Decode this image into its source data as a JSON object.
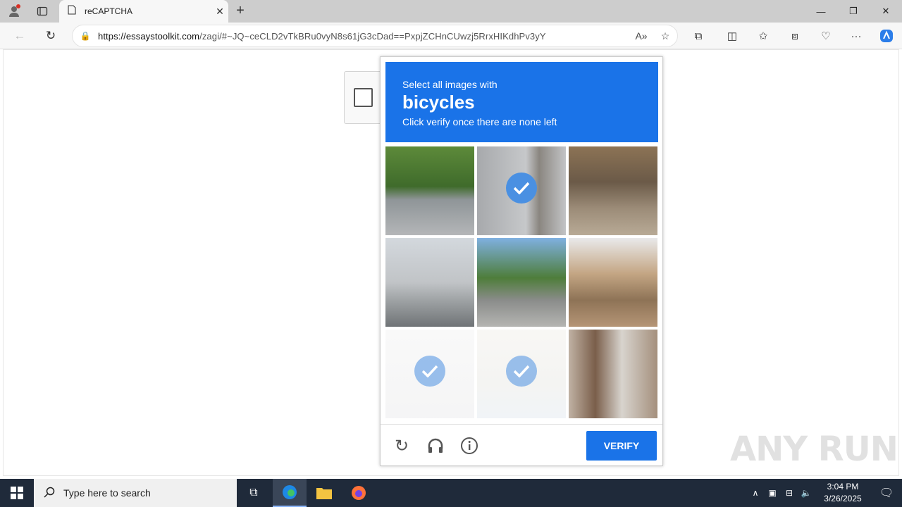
{
  "browser": {
    "tab_title": "reCAPTCHA",
    "url_host": "https://essaystoolkit.com",
    "url_path": "/zagi/#~JQ~ceCLD2vTkBRu0vyN8s61jG3cDad==PxpjZCHnCUwzj5RrxHIKdhPv3yY",
    "icons": [
      "profile-icon",
      "tab-actions-icon",
      "page-icon",
      "close-tab-icon",
      "new-tab-icon",
      "minimize-icon",
      "restore-icon",
      "close-window-icon",
      "back-icon",
      "refresh-icon",
      "lock-icon",
      "read-aloud-icon",
      "favorite-icon",
      "extensions-icon",
      "split-screen-icon",
      "favorites-icon",
      "collections-icon",
      "browser-essentials-icon",
      "more-icon",
      "copilot-icon"
    ]
  },
  "captcha": {
    "prompt_prefix": "Select all images with",
    "object": "bicycles",
    "instruction": "Click verify once there are none left",
    "tiles": [
      {
        "id": 1,
        "selected": false,
        "faded": false,
        "scene": "street with trees"
      },
      {
        "id": 2,
        "selected": true,
        "faded": false,
        "scene": "person riding bicycle"
      },
      {
        "id": 3,
        "selected": false,
        "faded": false,
        "scene": "market stall"
      },
      {
        "id": 4,
        "selected": false,
        "faded": false,
        "scene": "buildings and car"
      },
      {
        "id": 5,
        "selected": false,
        "faded": false,
        "scene": "street with sign"
      },
      {
        "id": 6,
        "selected": false,
        "faded": false,
        "scene": "apartment building"
      },
      {
        "id": 7,
        "selected": true,
        "faded": true,
        "scene": "street scene"
      },
      {
        "id": 8,
        "selected": true,
        "faded": true,
        "scene": "parked bicycles"
      },
      {
        "id": 9,
        "selected": false,
        "faded": false,
        "scene": "doorway with grille"
      }
    ],
    "verify_label": "VERIFY",
    "footer_icons": [
      "reload-icon",
      "audio-icon",
      "info-icon"
    ]
  },
  "watermark": "ANY RUN",
  "taskbar": {
    "search_placeholder": "Type here to search",
    "time": "3:04 PM",
    "date": "3/26/2025"
  }
}
